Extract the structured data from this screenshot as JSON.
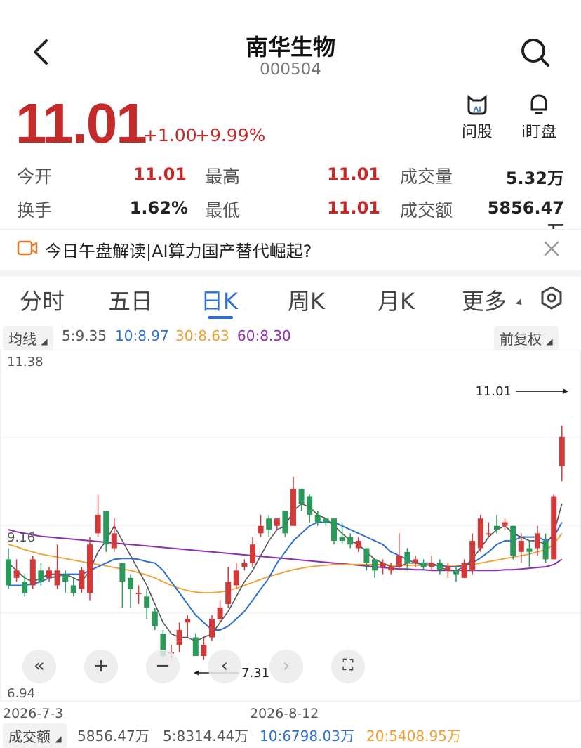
{
  "header": {
    "title": "南华生物",
    "code": "000504"
  },
  "quote": {
    "price": "11.01",
    "change": "+1.00",
    "change_pct": "+9.99%"
  },
  "tools": [
    {
      "label": "问股",
      "icon": "ai-cat-icon"
    },
    {
      "label": "i盯盘",
      "icon": "bell-icon"
    }
  ],
  "stats": {
    "open_label": "今开",
    "open": "11.01",
    "high_label": "最高",
    "high": "11.01",
    "volume_label": "成交量",
    "volume": "5.32万",
    "turnover_label": "换手",
    "turnover": "1.62%",
    "low_label": "最低",
    "low": "11.01",
    "amount_label": "成交额",
    "amount": "5856.47万"
  },
  "banner": {
    "text": "今日午盘解读|AI算力国产替代崛起?"
  },
  "tabs": [
    "分时",
    "五日",
    "日K",
    "周K",
    "月K",
    "更多"
  ],
  "ma_bar": {
    "label": "均线",
    "ma5": "5:9.35",
    "ma10": "10:8.97",
    "ma30": "30:8.63",
    "ma60": "60:8.30",
    "adjust": "前复权"
  },
  "footer": {
    "label": "成交额",
    "v0": "5856.47万",
    "v5": "5:8314.44万",
    "v10": "10:6798.03万",
    "v20": "20:5408.95万"
  },
  "colors": {
    "up": "#d23a3a",
    "down": "#2a9a5a",
    "ma5": "#555555",
    "ma10": "#2f6fd0",
    "ma30": "#f0a030",
    "ma60": "#8a2fb0",
    "accent": "#2f6fd0"
  },
  "chart_data": {
    "type": "candlestick",
    "y_ticks": [
      "11.38",
      "9.16",
      "6.94"
    ],
    "ylim": [
      6.94,
      11.38
    ],
    "x_ticks": [
      "2026-7-3",
      "2026-8-12"
    ],
    "annotations": {
      "high_marker": "11.01",
      "low_marker": "7.31"
    },
    "candles": [
      [
        8.75,
        8.4,
        8.9,
        8.35
      ],
      [
        8.5,
        8.6,
        8.75,
        8.45
      ],
      [
        8.45,
        8.3,
        8.55,
        8.25
      ],
      [
        8.4,
        8.75,
        8.8,
        8.35
      ],
      [
        8.6,
        8.45,
        8.7,
        8.4
      ],
      [
        8.5,
        8.6,
        8.65,
        8.45
      ],
      [
        8.4,
        8.6,
        8.95,
        8.35
      ],
      [
        8.55,
        8.45,
        8.6,
        8.3
      ],
      [
        8.4,
        8.3,
        8.5,
        8.25
      ],
      [
        8.35,
        8.6,
        8.65,
        8.3
      ],
      [
        8.3,
        8.95,
        9.05,
        8.2
      ],
      [
        9.1,
        9.35,
        9.62,
        9.05
      ],
      [
        9.4,
        8.95,
        9.4,
        8.85
      ],
      [
        8.9,
        9.1,
        9.3,
        8.85
      ],
      [
        8.7,
        8.45,
        8.65,
        8.1
      ],
      [
        8.5,
        8.35,
        8.55,
        8.1
      ],
      [
        8.3,
        8.3,
        8.4,
        8.15
      ],
      [
        8.25,
        8.1,
        8.35,
        7.95
      ],
      [
        8.05,
        7.85,
        8.1,
        7.8
      ],
      [
        7.75,
        7.45,
        7.8,
        7.4
      ],
      [
        7.5,
        7.5,
        7.6,
        7.4
      ],
      [
        7.6,
        7.8,
        7.9,
        7.5
      ],
      [
        7.9,
        7.95,
        8.0,
        7.7
      ],
      [
        7.7,
        7.45,
        7.75,
        7.45
      ],
      [
        7.45,
        7.6,
        7.7,
        7.4
      ],
      [
        7.7,
        7.95,
        8.0,
        7.65
      ],
      [
        7.95,
        8.1,
        8.2,
        7.9
      ],
      [
        8.15,
        8.45,
        8.65,
        8.1
      ],
      [
        8.4,
        8.6,
        8.7,
        8.35
      ],
      [
        8.65,
        8.7,
        8.75,
        8.6
      ],
      [
        8.7,
        8.95,
        9.05,
        8.65
      ],
      [
        9.1,
        9.2,
        9.35,
        9.05
      ],
      [
        9.3,
        9.15,
        9.35,
        9.05
      ],
      [
        9.2,
        9.3,
        9.3,
        9.15
      ],
      [
        9.4,
        9.1,
        9.3,
        9.05
      ],
      [
        9.2,
        9.7,
        9.86,
        9.5
      ],
      [
        9.7,
        9.5,
        9.65,
        9.4
      ],
      [
        9.6,
        9.35,
        9.62,
        9.25
      ],
      [
        9.35,
        9.25,
        9.4,
        9.2
      ],
      [
        9.3,
        9.25,
        9.3,
        9.2
      ],
      [
        9.3,
        9.0,
        9.15,
        8.95
      ],
      [
        9.05,
        9.0,
        9.25,
        8.95
      ],
      [
        9.05,
        8.95,
        9.1,
        8.9
      ],
      [
        8.9,
        9.0,
        9.05,
        8.85
      ],
      [
        8.9,
        8.7,
        8.9,
        8.6
      ],
      [
        8.75,
        8.6,
        8.75,
        8.5
      ],
      [
        8.65,
        8.7,
        8.75,
        8.55
      ],
      [
        8.6,
        8.65,
        8.7,
        8.55
      ],
      [
        8.65,
        8.8,
        9.1,
        8.6
      ],
      [
        8.85,
        8.7,
        8.9,
        8.6
      ],
      [
        8.7,
        8.75,
        8.8,
        8.65
      ],
      [
        8.7,
        8.65,
        8.75,
        8.6
      ],
      [
        8.65,
        8.7,
        8.8,
        8.6
      ],
      [
        8.7,
        8.6,
        8.75,
        8.55
      ],
      [
        8.6,
        8.65,
        8.7,
        8.5
      ],
      [
        8.6,
        8.55,
        8.65,
        8.45
      ],
      [
        8.5,
        8.7,
        8.75,
        8.5
      ],
      [
        8.6,
        9.0,
        9.1,
        8.55
      ],
      [
        8.9,
        9.3,
        9.35,
        8.85
      ],
      [
        9.1,
        9.1,
        9.25,
        9.05
      ],
      [
        9.2,
        9.15,
        9.35,
        9.1
      ],
      [
        9.2,
        9.25,
        9.3,
        9.15
      ],
      [
        9.2,
        8.8,
        9.2,
        8.75
      ],
      [
        8.85,
        9.0,
        9.1,
        8.7
      ],
      [
        8.9,
        8.85,
        9.0,
        8.65
      ],
      [
        8.9,
        9.1,
        9.2,
        8.8
      ],
      [
        9.0,
        8.75,
        9.1,
        8.7
      ],
      [
        8.75,
        9.6,
        9.62,
        8.75
      ],
      [
        10.0,
        10.4,
        10.55,
        9.8
      ]
    ],
    "ma5": [
      8.7,
      8.6,
      8.5,
      8.45,
      8.5,
      8.55,
      8.55,
      8.55,
      8.5,
      8.45,
      8.6,
      8.85,
      9.0,
      9.2,
      9.0,
      8.8,
      8.6,
      8.4,
      8.15,
      7.9,
      7.75,
      7.7,
      7.7,
      7.65,
      7.7,
      7.75,
      7.9,
      8.05,
      8.25,
      8.45,
      8.6,
      8.8,
      9.0,
      9.15,
      9.2,
      9.4,
      9.5,
      9.45,
      9.35,
      9.3,
      9.2,
      9.1,
      9.0,
      8.95,
      8.85,
      8.75,
      8.7,
      8.65,
      8.65,
      8.7,
      8.7,
      8.7,
      8.7,
      8.65,
      8.6,
      8.6,
      8.65,
      8.75,
      8.9,
      9.05,
      9.15,
      9.2,
      9.1,
      9.05,
      9.0,
      9.0,
      8.95,
      9.1,
      9.5
    ],
    "ma10": [
      8.4,
      8.4,
      8.4,
      8.42,
      8.45,
      8.5,
      8.52,
      8.55,
      8.55,
      8.55,
      8.6,
      8.65,
      8.7,
      8.75,
      8.76,
      8.76,
      8.75,
      8.72,
      8.7,
      8.6,
      8.45,
      8.3,
      8.15,
      8.0,
      7.9,
      7.8,
      7.8,
      7.85,
      7.95,
      8.05,
      8.2,
      8.35,
      8.5,
      8.7,
      8.85,
      9.0,
      9.1,
      9.2,
      9.25,
      9.25,
      9.25,
      9.2,
      9.15,
      9.1,
      9.05,
      9.0,
      8.95,
      8.85,
      8.8,
      8.75,
      8.7,
      8.68,
      8.67,
      8.67,
      8.65,
      8.65,
      8.67,
      8.7,
      8.77,
      8.85,
      8.95,
      9.0,
      9.0,
      9.05,
      9.05,
      9.05,
      9.0,
      9.05,
      9.25
    ],
    "ma30": [
      8.95,
      8.92,
      8.88,
      8.85,
      8.82,
      8.8,
      8.78,
      8.76,
      8.74,
      8.72,
      8.7,
      8.68,
      8.66,
      8.64,
      8.62,
      8.6,
      8.57,
      8.54,
      8.5,
      8.45,
      8.4,
      8.36,
      8.33,
      8.31,
      8.3,
      8.3,
      8.31,
      8.33,
      8.36,
      8.4,
      8.44,
      8.48,
      8.52,
      8.55,
      8.58,
      8.61,
      8.63,
      8.65,
      8.66,
      8.67,
      8.68,
      8.68,
      8.68,
      8.68,
      8.68,
      8.68,
      8.68,
      8.67,
      8.67,
      8.67,
      8.67,
      8.67,
      8.67,
      8.67,
      8.67,
      8.67,
      8.67,
      8.68,
      8.7,
      8.72,
      8.74,
      8.76,
      8.78,
      8.8,
      8.82,
      8.85,
      8.88,
      8.95,
      9.1
    ],
    "ma60": [
      9.15,
      9.12,
      9.1,
      9.08,
      9.06,
      9.05,
      9.04,
      9.03,
      9.02,
      9.01,
      9.0,
      8.99,
      8.98,
      8.97,
      8.96,
      8.95,
      8.94,
      8.93,
      8.92,
      8.91,
      8.9,
      8.89,
      8.88,
      8.87,
      8.86,
      8.85,
      8.84,
      8.83,
      8.82,
      8.81,
      8.8,
      8.79,
      8.78,
      8.77,
      8.76,
      8.75,
      8.74,
      8.73,
      8.72,
      8.71,
      8.7,
      8.69,
      8.68,
      8.67,
      8.66,
      8.65,
      8.64,
      8.63,
      8.62,
      8.62,
      8.61,
      8.61,
      8.6,
      8.6,
      8.6,
      8.6,
      8.6,
      8.6,
      8.6,
      8.6,
      8.6,
      8.61,
      8.61,
      8.62,
      8.63,
      8.64,
      8.65,
      8.68,
      8.75
    ]
  }
}
